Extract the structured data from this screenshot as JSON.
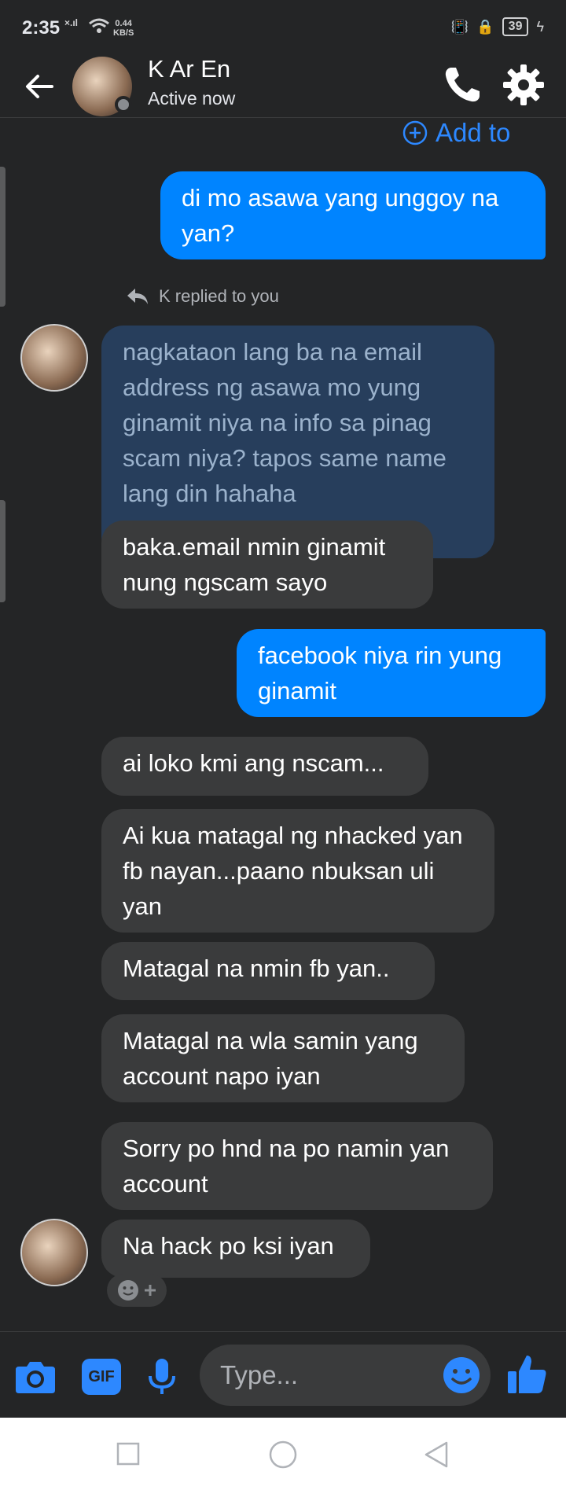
{
  "status": {
    "time": "2:35",
    "network": "×.ıl",
    "speed_value": "0.44",
    "speed_unit": "KB/S",
    "battery": "39"
  },
  "header": {
    "name": "K Ar En",
    "status": "Active now"
  },
  "add_to": {
    "label": "Add to"
  },
  "reply_note": {
    "text": "K replied to you"
  },
  "messages": [
    {
      "text": "di mo asawa yang unggoy na yan?"
    },
    {
      "text": "nagkataon lang ba na email address ng asawa mo yung ginamit niya na info sa pinag scam niya? tapos same name lang din hahaha"
    },
    {
      "text": "baka.email nmin ginamit nung ngscam sayo"
    },
    {
      "text": "facebook niya rin yung ginamit"
    },
    {
      "text": "ai loko kmi ang nscam..."
    },
    {
      "text": "Ai kua matagal ng nhacked yan fb nayan...paano nbuksan uli yan"
    },
    {
      "text": "Matagal na nmin fb yan.."
    },
    {
      "text": "Matagal na wla samin yang account napo iyan"
    },
    {
      "text": "Sorry po hnd na po namin yan account"
    },
    {
      "text": "Na hack po ksi iyan"
    }
  ],
  "composer": {
    "placeholder": "Type...",
    "gif_label": "GIF"
  },
  "colors": {
    "accent": "#0084ff",
    "background": "#242526",
    "incoming": "#3a3b3c",
    "quoted": "#273e5c"
  }
}
